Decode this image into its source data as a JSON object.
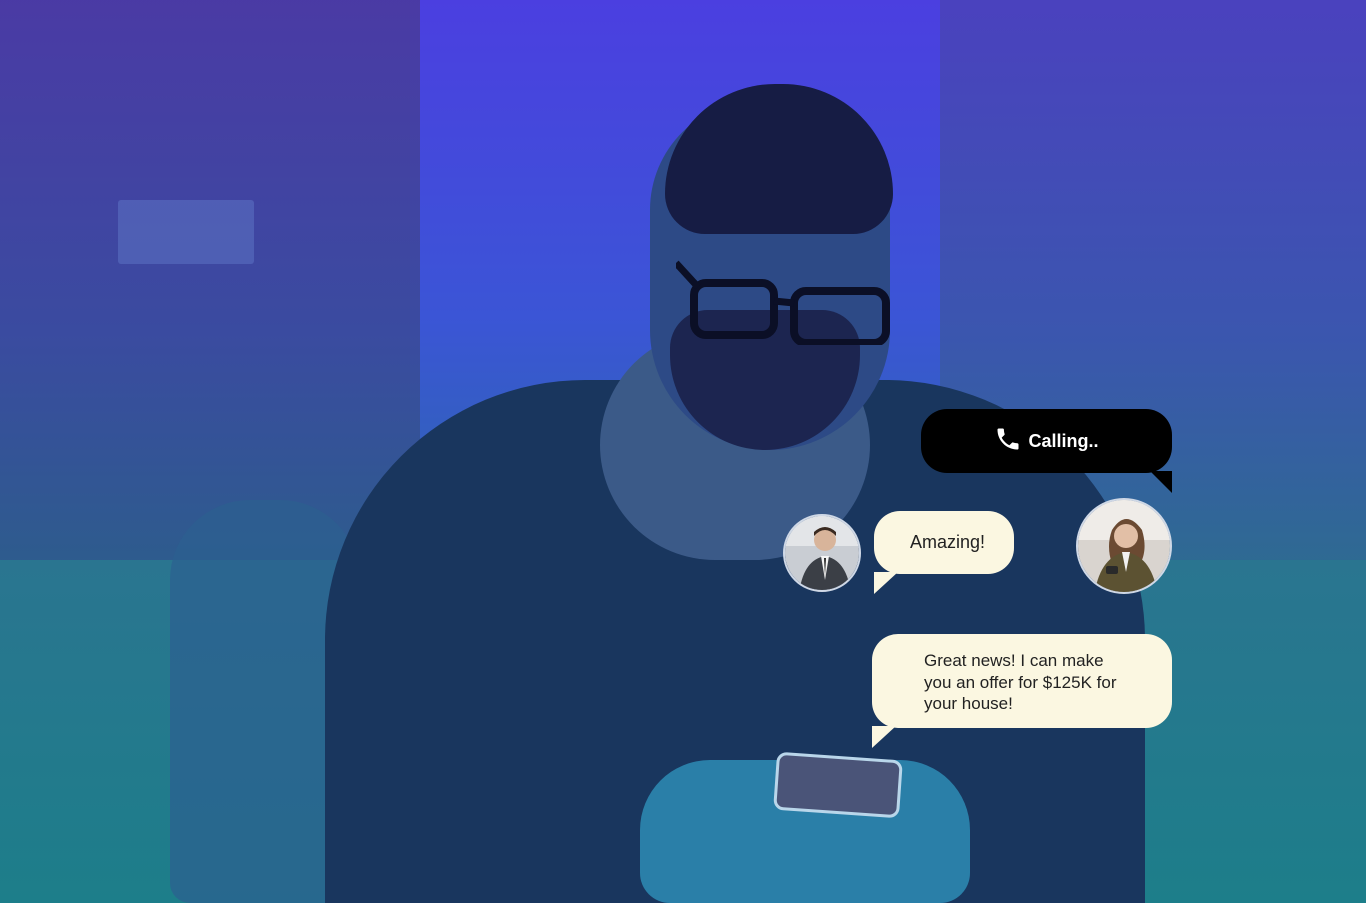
{
  "calling": {
    "text": "Calling..",
    "icon": "phone-icon"
  },
  "messages": [
    {
      "text": "Amazing!"
    },
    {
      "text": "Great news! I can make you an offer for $125K for your house!"
    }
  ],
  "colors": {
    "calling_bubble": "#000000",
    "message_bubble": "#fbf7e1",
    "overlay": "#4b3fe0"
  }
}
